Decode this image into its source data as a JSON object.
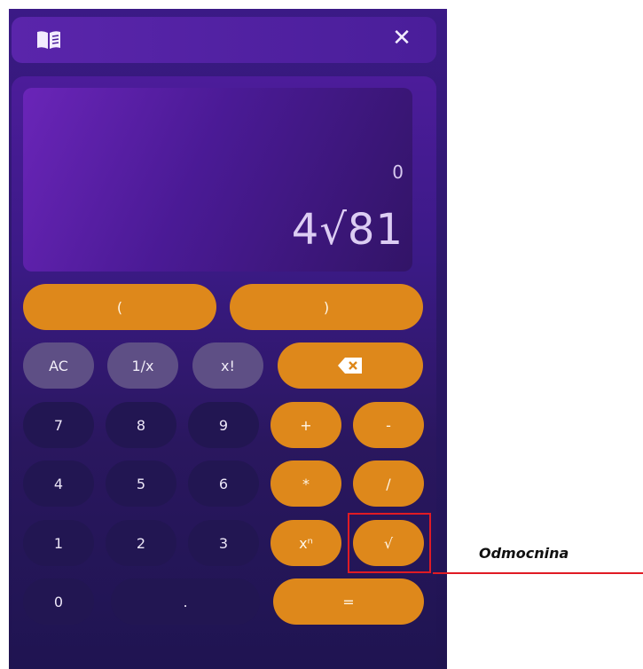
{
  "header": {
    "book_icon": "book-icon",
    "close_icon": "close-icon",
    "close_glyph": "✕"
  },
  "display": {
    "previous_result": "0",
    "expression": "4√81"
  },
  "keys": {
    "open_paren": "(",
    "close_paren": ")",
    "ac": "AC",
    "reciprocal": "1/x",
    "factorial": "x!",
    "backspace_icon": "backspace-icon",
    "seven": "7",
    "eight": "8",
    "nine": "9",
    "plus": "+",
    "minus": "-",
    "four": "4",
    "five": "5",
    "six": "6",
    "multiply": "*",
    "divide": "/",
    "one": "1",
    "two": "2",
    "three": "3",
    "power": "xⁿ",
    "sqrt": "√",
    "zero": "0",
    "dot": ".",
    "equals": "="
  },
  "annotation": {
    "label": "Odmocnina"
  },
  "colors": {
    "accent": "#de881b",
    "annotation": "#e01b24",
    "background": "#2b1767"
  }
}
